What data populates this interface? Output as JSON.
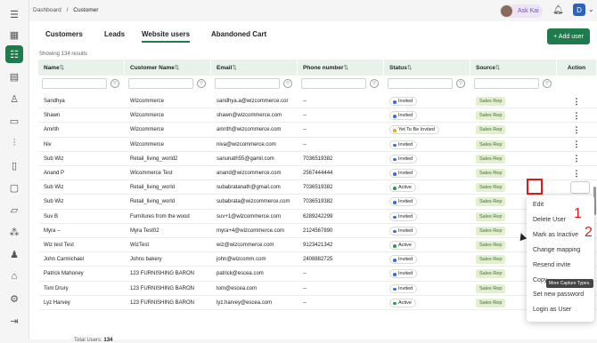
{
  "breadcrumb": [
    "Dashboard",
    "/",
    "Customer"
  ],
  "topbar": {
    "ask_label": "Ask Kai",
    "user_initial": "D"
  },
  "tabs": [
    {
      "label": "Customers",
      "active": false
    },
    {
      "label": "Leads",
      "active": false
    },
    {
      "label": "Website users",
      "active": true
    },
    {
      "label": "Abandoned Cart",
      "active": false
    }
  ],
  "add_button": "+ Add user",
  "showing": "Showing 134 results",
  "columns": [
    "Name",
    "Customer Name",
    "Email",
    "Phone number",
    "Status",
    "Source",
    "Action"
  ],
  "rows": [
    {
      "name": "Sandhya",
      "customer": "Wizcommerce",
      "email": "sandhya.a@wizcommerce.cor",
      "phone": "--",
      "status": "Invited",
      "source": "Sales Rep"
    },
    {
      "name": "Shawn",
      "customer": "Wizcommerce",
      "email": "shawn@wizcommerce.com",
      "phone": "--",
      "status": "Invited",
      "source": "Sales Rep"
    },
    {
      "name": "Amrith",
      "customer": "Wizcommerce",
      "email": "amrith@wizcommerce.com",
      "phone": "--",
      "status": "Yet To Be Invited",
      "source": "Sales Rep"
    },
    {
      "name": "Niv",
      "customer": "Wizcommerce",
      "email": "niva@wizcommerce.com",
      "phone": "--",
      "status": "Invited",
      "source": "Sales Rep"
    },
    {
      "name": "Sub Wiz",
      "customer": "Retail_living_world2",
      "email": "sanunath55@gamil.com",
      "phone": "7036519382",
      "status": "Invited",
      "source": "Sales Rep"
    },
    {
      "name": "Anand P",
      "customer": "Wicommerce Test",
      "email": "anand@wizcommerce.com",
      "phone": "2567444444",
      "status": "Invited",
      "source": "Sales Rep"
    },
    {
      "name": "Sub Wiz",
      "customer": "Retail_living_world",
      "email": "subabratanath@gmail.com",
      "phone": "7036519382",
      "status": "Active",
      "source": "Sales Rep"
    },
    {
      "name": "Sub Wiz",
      "customer": "Retail_living_world",
      "email": "subabrata@wizcommerce.com",
      "phone": "7036519382",
      "status": "Invited",
      "source": "Sales Rep"
    },
    {
      "name": "Suv B",
      "customer": "Furnitures from the wood",
      "email": "suv+1@wizcommerce.com",
      "phone": "6289242299",
      "status": "Invited",
      "source": "Sales Rep"
    },
    {
      "name": "Myra --",
      "customer": "Myra Test02",
      "email": "myra+4@wizcommerce.com",
      "phone": "2124567890",
      "status": "Invited",
      "source": "Sales Rep"
    },
    {
      "name": "Wiz test Test",
      "customer": "WizTest",
      "email": "wiz@wizcommerce.com",
      "phone": "9123421342",
      "status": "Active",
      "source": "Sales Rep"
    },
    {
      "name": "John Carmichael",
      "customer": "Johns bakery",
      "email": "john@wizcomm.com",
      "phone": "2408882725",
      "status": "Invited",
      "source": "Sales Rep"
    },
    {
      "name": "Patrick Mahoney",
      "customer": "123 FURNISHING BARON",
      "email": "patrick@escea.com",
      "phone": "--",
      "status": "Invited",
      "source": "Sales Rep"
    },
    {
      "name": "Tom Drury",
      "customer": "123 FURNISHING BARON",
      "email": "tom@escea.com",
      "phone": "--",
      "status": "Invited",
      "source": "Sales Rep"
    },
    {
      "name": "Lyz Harvey",
      "customer": "123 FURNISHING BARON",
      "email": "lyz.harvey@escea.com",
      "phone": "--",
      "status": "Active",
      "source": "Sales Rep"
    }
  ],
  "status_colors": {
    "Invited": "#3b6fd4",
    "Active": "#2e9a4f",
    "Yet To Be Invited": "#e8a33a"
  },
  "menu": [
    "Edit",
    "Delete User",
    "Mark as Inactive",
    "Change mapping",
    "Resend invite",
    "Copy",
    "Set new password",
    "Login as User"
  ],
  "tooltip": "More Capture Types.",
  "annotations": [
    "1",
    "2"
  ],
  "total_label": "Total Users:",
  "total_value": "134"
}
